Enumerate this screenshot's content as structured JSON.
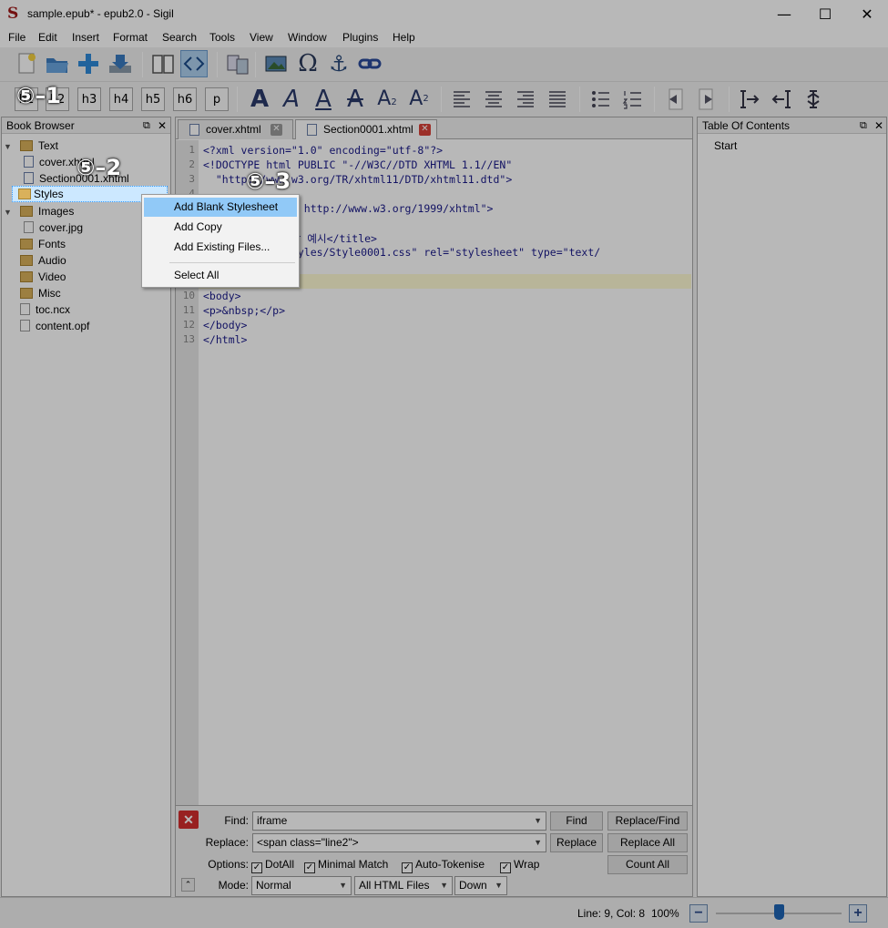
{
  "window": {
    "title": "sample.epub* - epub2.0 - Sigil",
    "logo_letter": "S",
    "minimize": "—",
    "maximize": "☐",
    "close": "✕"
  },
  "menu": [
    "File",
    "Edit",
    "Insert",
    "Format",
    "Search",
    "Tools",
    "View",
    "Window",
    "Plugins",
    "Help"
  ],
  "toolbar2": {
    "headings": [
      "h1",
      "h2",
      "h3",
      "h4",
      "h5",
      "h6",
      "p"
    ]
  },
  "book_browser": {
    "title": "Book Browser",
    "items": [
      {
        "label": "Text"
      },
      {
        "label": "cover.xhtml"
      },
      {
        "label": "Section0001.xhtml"
      },
      {
        "label": "Styles"
      },
      {
        "label": "Images"
      },
      {
        "label": "cover.jpg"
      },
      {
        "label": "Fonts"
      },
      {
        "label": "Audio"
      },
      {
        "label": "Video"
      },
      {
        "label": "Misc"
      },
      {
        "label": "toc.ncx"
      },
      {
        "label": "content.opf"
      }
    ]
  },
  "context_menu": {
    "items": [
      "Add Blank Stylesheet",
      "Add Copy",
      "Add Existing Files...",
      "Select All"
    ]
  },
  "editor": {
    "tabs": [
      {
        "label": "cover.xhtml"
      },
      {
        "label": "Section0001.xhtml"
      }
    ],
    "line_numbers": [
      "1",
      "2",
      "3",
      "4",
      "5",
      "6",
      "7",
      "8",
      "9",
      "10",
      "11",
      "12",
      "13"
    ],
    "lines": [
      "<?xml version=\"1.0\" encoding=\"utf-8\"?>",
      "<!DOCTYPE html PUBLIC \"-//W3C//DTD XHTML 1.1//EN\"",
      "  \"http://www.w3.org/TR/xhtml11/DTD/xhtml11.dtd\">",
      "",
      "                http://www.w3.org/1999/xhtml\">",
      "",
      "              장 예시</title>",
      "          ../Styles/Style0001.css\" rel=\"stylesheet\" type=\"text/",
      "",
      "<body>",
      "<p>&nbsp;</p>",
      "</body>",
      "</html>"
    ]
  },
  "find_panel": {
    "find_label": "Find:",
    "find_value": "iframe",
    "replace_label": "Replace:",
    "replace_value": "<span class=\"line2\">",
    "options_label": "Options:",
    "options": [
      "DotAll",
      "Minimal Match",
      "Auto-Tokenise",
      "Wrap"
    ],
    "mode_label": "Mode:",
    "mode_value": "Normal",
    "scope_value": "All HTML Files",
    "direction_value": "Down",
    "buttons": {
      "find": "Find",
      "replace_find": "Replace/Find",
      "replace": "Replace",
      "replace_all": "Replace All",
      "count_all": "Count All"
    }
  },
  "toc": {
    "title": "Table Of Contents",
    "items": [
      "Start"
    ]
  },
  "status": {
    "position": "Line: 9, Col: 8",
    "zoom": "100%"
  },
  "annotations": [
    "⑤–1",
    "⑤–2",
    "⑤–3"
  ],
  "colors": {
    "accent_highlight": "#91c9f7",
    "selection": "#cce8ff",
    "close_tab_red": "#d9423a"
  }
}
